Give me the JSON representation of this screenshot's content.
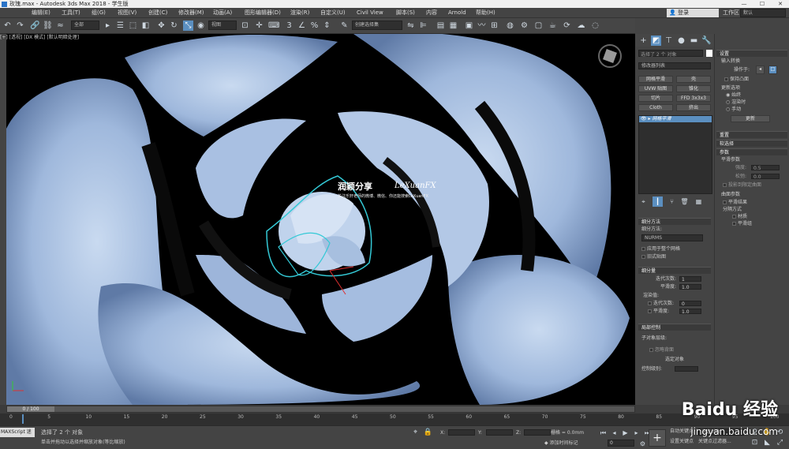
{
  "window": {
    "title": "玫瑰.max - Autodesk 3ds Max 2018  - 学生版"
  },
  "menus": [
    "编辑(E)",
    "工具(T)",
    "组(G)",
    "视图(V)",
    "创建(C)",
    "修改器(M)",
    "动画(A)",
    "图形编辑器(D)",
    "渲染(R)",
    "自定义(U)",
    "Civil View",
    "脚本(S)",
    "内容",
    "Arnold",
    "帮助(H)"
  ],
  "account": {
    "login": "登录",
    "workspace_label": "工作区",
    "workspace_value": "默认"
  },
  "toolbar": {
    "filter": "全部",
    "selection_set": "创建选择集",
    "view_dropdown": "视图"
  },
  "viewport": {
    "label": "[+] [透视] [DX 模式] [默认明暗处理]",
    "logo_title": "润颖分享",
    "logo_brand": "LeXuanFX",
    "logo_sub": "关注乐轩老师的微博、微信、你还能搜索LeXuanFX"
  },
  "command_panel": {
    "object_name": "选择了 2 个 对象",
    "modifier_list": "修改器列表",
    "buttons": [
      "网格平滑",
      "壳",
      "UVW 贴图",
      "锥化",
      "切片",
      "FFD 3x3x3",
      "Cloth",
      "挤出"
    ],
    "stack_item": "网格平滑",
    "subdivision_method_title": "细分方法",
    "subdivision_method_label": "细分方法:",
    "subdivision_method_value": "NURMS",
    "apply_whole": "应用于整个网格",
    "old_style": "旧式贴图",
    "subdivision_amount_title": "细分量",
    "iterations": "迭代次数:",
    "iterations_value": "1",
    "smoothness": "平滑度:",
    "smoothness_value": "1.0",
    "render_values": "渲染值:",
    "render_iterations": "迭代次数:",
    "render_iterations_value": "0",
    "render_smoothness": "平滑度:",
    "render_smoothness_value": "1.0",
    "local_control_title": "局部控制",
    "sub_object_level": "子对象层级:",
    "ignore_backface": "忽略背面",
    "select_object": "选定对象",
    "control_level": "控制级别:"
  },
  "right_panel": {
    "settings_title": "设置",
    "input_conversion": "输入转换",
    "operate_on": "操作于:",
    "keep_convex": "保持凸面",
    "update_options": "更新选项",
    "always": "始终",
    "when_rendering": "渲染时",
    "manually": "手动",
    "update_button": "更新",
    "reset_title": "重置",
    "soft_selection_title": "软选择",
    "parameters_title": "参数",
    "smoothing_params": "平滑参数",
    "strength": "强度:",
    "strength_value": "0.5",
    "relax": "松弛:",
    "relax_value": "0.0",
    "project_limit": "投影到限定曲面",
    "surface_params": "曲面参数",
    "smooth_result": "平滑结果",
    "separate_by": "分隔方式",
    "materials": "材质",
    "smoothing_groups": "平滑组"
  },
  "timeline": {
    "frame": "0 / 100",
    "ticks": [
      "0",
      "5",
      "10",
      "15",
      "20",
      "25",
      "30",
      "35",
      "40",
      "45",
      "50",
      "55",
      "60",
      "65",
      "70",
      "75",
      "80",
      "85",
      "90",
      "95",
      "100"
    ]
  },
  "status": {
    "maxscript": "MAXScript 迷",
    "selected": "选择了 2 个 对象",
    "hint": "单击并拖动以选择并缩放对象(等比缩放)",
    "x_label": "X:",
    "y_label": "Y:",
    "z_label": "Z:",
    "grid": "栅格 = 0.0mm",
    "add_time_tag": "添加时间标记",
    "auto_key": "自动关键点",
    "selected_object": "选定对象",
    "set_key": "设置关键点",
    "key_filter": "关键点过滤器...",
    "frame_value": "0"
  },
  "watermark": {
    "main": "Baidu 经验",
    "url": "jingyan.baidu.com"
  },
  "colors": {
    "accent": "#5b8fc0",
    "rose": "#8fa9cf",
    "selection": "#34c9d6"
  }
}
